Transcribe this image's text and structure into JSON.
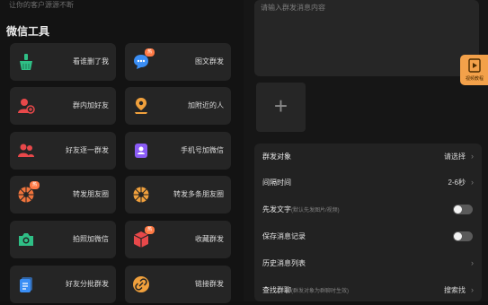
{
  "left": {
    "subtitle": "让你的客户源源不断",
    "section_title": "微信工具",
    "cards": [
      {
        "label": "看谁删了我",
        "icon": "broom-icon"
      },
      {
        "label": "图文群发",
        "icon": "chat-bubble-icon",
        "badge": "热"
      },
      {
        "label": "群内加好友",
        "icon": "user-add-icon"
      },
      {
        "label": "加附近的人",
        "icon": "location-pin-icon"
      },
      {
        "label": "好友逐一群发",
        "icon": "users-icon"
      },
      {
        "label": "手机号加微信",
        "icon": "phone-user-icon"
      },
      {
        "label": "转发朋友圈",
        "icon": "shutter-icon",
        "badge": "热"
      },
      {
        "label": "转发多条朋友圈",
        "icon": "shutter-icon"
      },
      {
        "label": "拍照加微信",
        "icon": "camera-icon"
      },
      {
        "label": "收藏群发",
        "icon": "cube-icon",
        "badge": "热"
      },
      {
        "label": "好友分批群发",
        "icon": "document-icon"
      },
      {
        "label": "链接群发",
        "icon": "link-icon"
      }
    ]
  },
  "right": {
    "message_placeholder": "请输入群发消息内容",
    "add_symbol": "+",
    "video_tab_label": "视频教程",
    "rows": [
      {
        "label": "群发对象",
        "sub": "",
        "value": "请选择",
        "chevron": "›"
      },
      {
        "label": "间隔时间",
        "sub": "",
        "value": "2-6秒",
        "chevron": "›"
      },
      {
        "label": "先发文字",
        "sub": "(默认先发图片/视频)",
        "toggle": false
      },
      {
        "label": "保存消息记录",
        "sub": "",
        "toggle": false
      },
      {
        "label": "历史消息列表",
        "sub": "",
        "value": "",
        "chevron": "›"
      },
      {
        "label": "查找群聊",
        "sub": "(群发对象为群聊时生效)",
        "value": "搜索找",
        "chevron": "›"
      }
    ]
  },
  "colors": {
    "green": "#2fbf86",
    "blue": "#3a8ef5",
    "red": "#e8484a",
    "orange": "#f0a03c",
    "purple": "#8b5cf6",
    "badge": "#ff7a45"
  }
}
